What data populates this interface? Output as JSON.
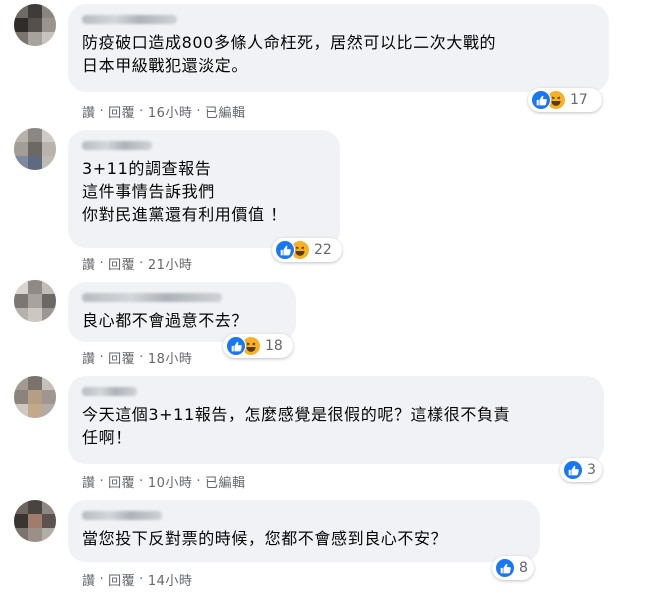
{
  "comments": [
    {
      "text": "防疫破口造成800多條人命枉死，居然可以比二次大戰的\n日本甲級戰犯還淡定。",
      "reaction_count": "17",
      "reactions": [
        "like-icon",
        "haha-icon"
      ],
      "actions": {
        "like": "讚",
        "reply": "回覆",
        "time": "16小時",
        "edited": "已編輯"
      }
    },
    {
      "text": "3+11的調查報告\n這件事情告訴我們\n你對民進黨還有利用價值 ！",
      "reaction_count": "22",
      "reactions": [
        "like-icon",
        "haha-icon"
      ],
      "actions": {
        "like": "讚",
        "reply": "回覆",
        "time": "21小時"
      }
    },
    {
      "text": "良心都不會過意不去？",
      "reaction_count": "18",
      "reactions": [
        "like-icon",
        "haha-icon"
      ],
      "actions": {
        "like": "讚",
        "reply": "回覆",
        "time": "18小時"
      }
    },
    {
      "text": "今天這個3+11報告，怎麼感覺是很假的呢？這樣很不負責\n任啊！",
      "reaction_count": "3",
      "reactions": [
        "like-icon"
      ],
      "actions": {
        "like": "讚",
        "reply": "回覆",
        "time": "10小時",
        "edited": "已編輯"
      }
    },
    {
      "text": "當您投下反對票的時候，您都不會感到良心不安？",
      "reaction_count": "8",
      "reactions": [
        "like-icon"
      ],
      "actions": {
        "like": "讚",
        "reply": "回覆",
        "time": "14小時"
      }
    }
  ],
  "separator": "·",
  "colors": {
    "bubble": "#f0f2f5",
    "like": "#1877f2",
    "haha": "#f7b125",
    "meta": "#65676b"
  }
}
